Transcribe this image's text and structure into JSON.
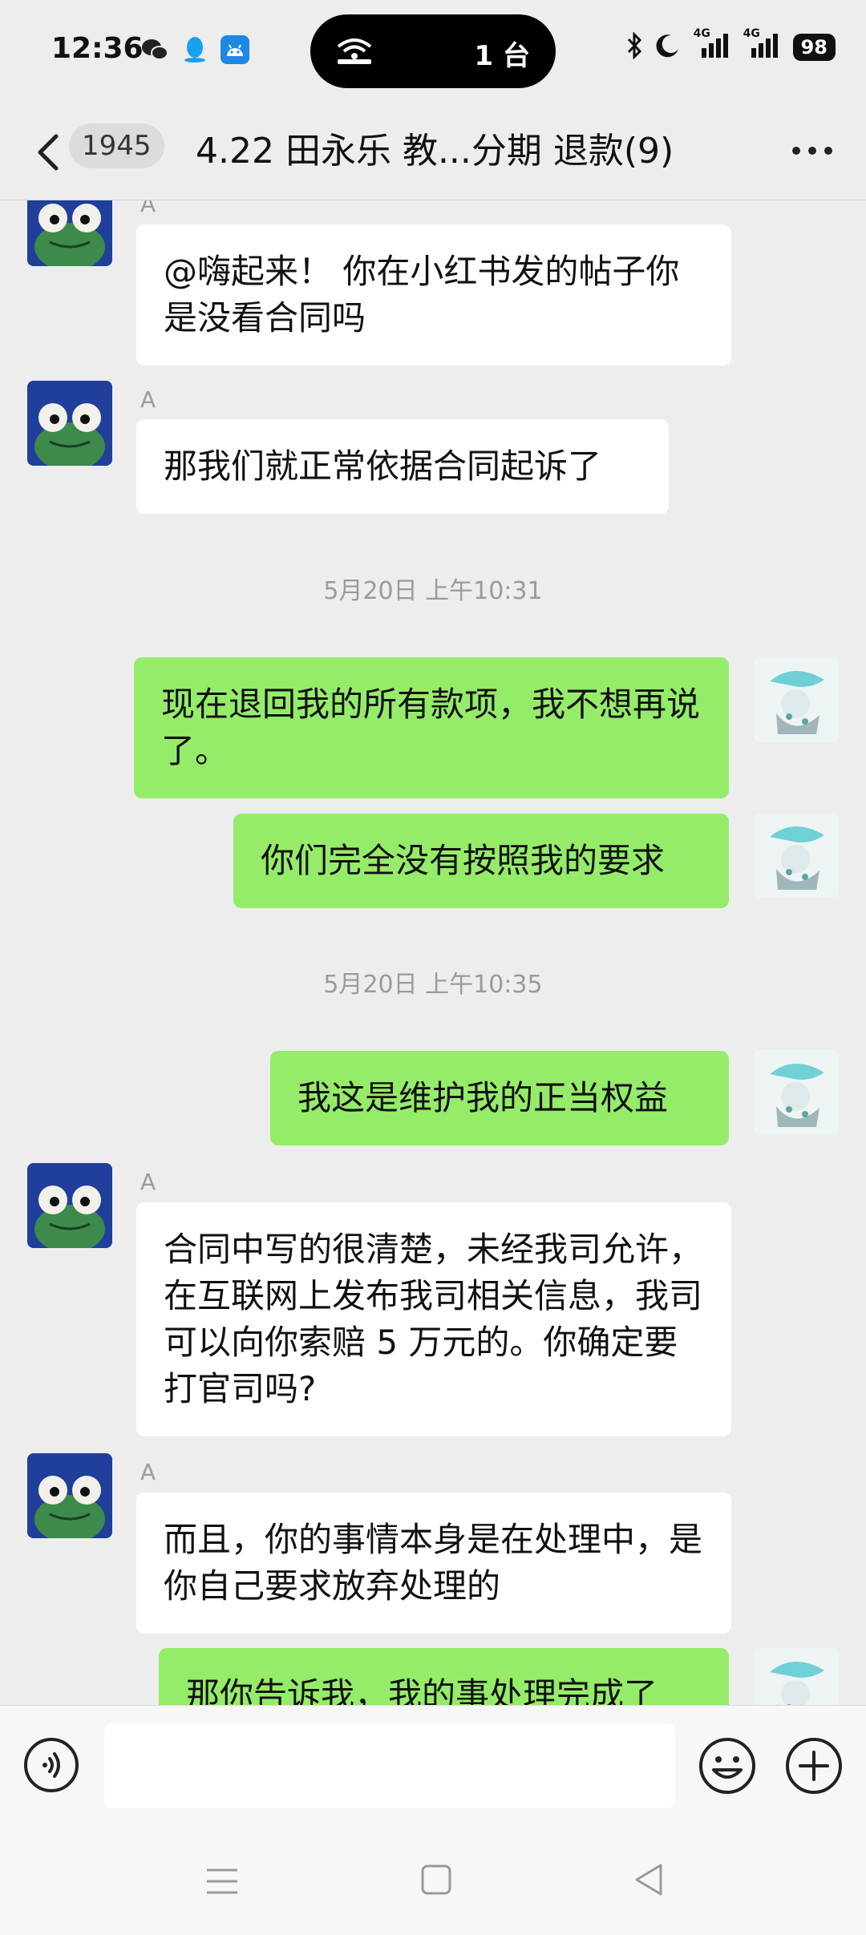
{
  "status_bar": {
    "time": "12:36",
    "island_text": "1 台",
    "battery": "98",
    "net1": "4G",
    "net2": "4G"
  },
  "header": {
    "unread_count": "1945",
    "title": "4.22 田永乐 教...分期 退款(9)"
  },
  "messages": [
    {
      "type": "in",
      "sender": "A",
      "text": "@嗨起来！  你在小红书发的帖子你是没看合同吗"
    },
    {
      "type": "in",
      "sender": "A",
      "text": "那我们就正常依据合同起诉了"
    },
    {
      "type": "time",
      "text": "5月20日 上午10:31"
    },
    {
      "type": "out",
      "text": "现在退回我的所有款项，我不想再说了。"
    },
    {
      "type": "out",
      "text": "你们完全没有按照我的要求"
    },
    {
      "type": "time",
      "text": "5月20日 上午10:35"
    },
    {
      "type": "out",
      "text": "我这是维护我的正当权益"
    },
    {
      "type": "in",
      "sender": "A",
      "text": "合同中写的很清楚，未经我司允许，在互联网上发布我司相关信息，我司可以向你索赔 5 万元的。你确定要打官司吗?"
    },
    {
      "type": "in",
      "sender": "A",
      "text": "而且，你的事情本身是在处理中，是你自己要求放弃处理的"
    },
    {
      "type": "out",
      "text": "那你告诉我，我的事处理完成了"
    }
  ],
  "input": {
    "value": "",
    "placeholder": ""
  },
  "colors": {
    "incoming_bubble": "#ffffff",
    "outgoing_bubble": "#95ec69",
    "background": "#ededed"
  },
  "icons": {
    "back": "chevron-left-icon",
    "more": "more-dots-icon",
    "voice": "voice-icon",
    "emoji": "emoji-icon",
    "plus": "plus-icon"
  }
}
